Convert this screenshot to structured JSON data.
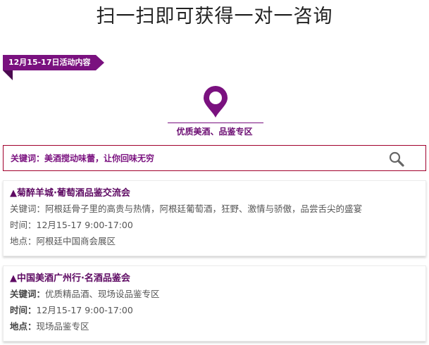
{
  "header": {
    "title": "扫一扫即可获得一对一咨询"
  },
  "ribbon": {
    "label": "12月15-17日活动内容"
  },
  "category": {
    "icon": "map-pin-icon",
    "label": "优质美酒、品鉴专区"
  },
  "search": {
    "text": "关键词：美酒搅动味蕾，让你回味无穷",
    "icon": "magnifier-icon"
  },
  "events": [
    {
      "title": "▲菊醉羊城·葡萄酒品鉴交流会",
      "keywords_label": "关键词：",
      "keywords": "阿根廷骨子里的高贵与热情，阿根廷葡萄酒，狂野、激情与骄傲，品尝舌尖的盛宴",
      "time_label": "时间：",
      "time": "12月15-17 9:00-17:00",
      "place_label": "地点：",
      "place": "阿根廷中国商会展区"
    },
    {
      "title": "▲中国美酒广州行·名酒品鉴会",
      "keywords_label": "关键词：",
      "keywords": "优质精品酒、现场设品鉴专区",
      "time_label": "时间：",
      "time": "12月15-17 9:00-17:00",
      "place_label": "地点：",
      "place": "现场品鉴专区"
    }
  ],
  "colors": {
    "accent": "#7a117f",
    "border": "#a1002c"
  }
}
